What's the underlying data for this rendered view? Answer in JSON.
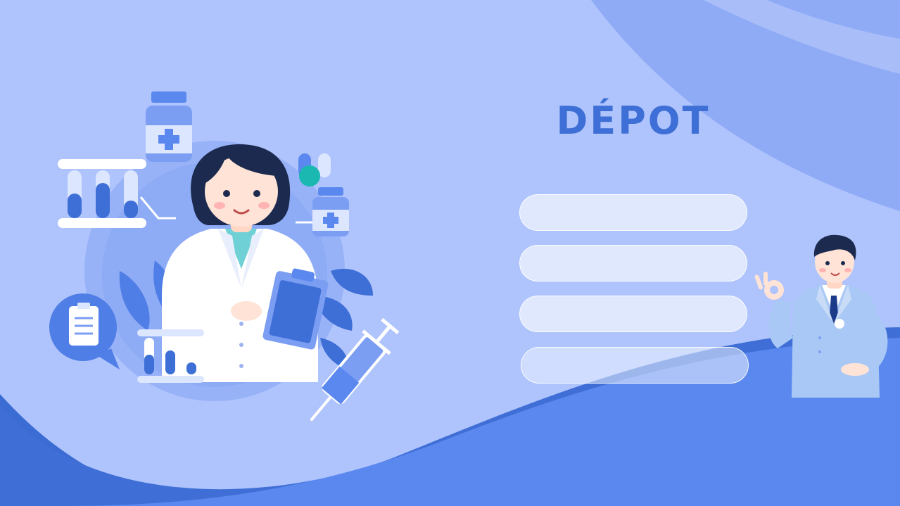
{
  "slide": {
    "title": "DÉPOT",
    "items": [
      {
        "label": ""
      },
      {
        "label": ""
      },
      {
        "label": ""
      },
      {
        "label": ""
      }
    ]
  },
  "colors": {
    "background": "#afc3fc",
    "title": "#3d6fd6",
    "wave_dark": "#3b6cd3",
    "wave_mid": "#5b88ef",
    "accent_teal": "#1ab8b0",
    "navy": "#1b2a4e"
  },
  "illustrations": {
    "left": "doctor-with-clipboard-illustration",
    "right": "doctor-ok-gesture-illustration"
  }
}
